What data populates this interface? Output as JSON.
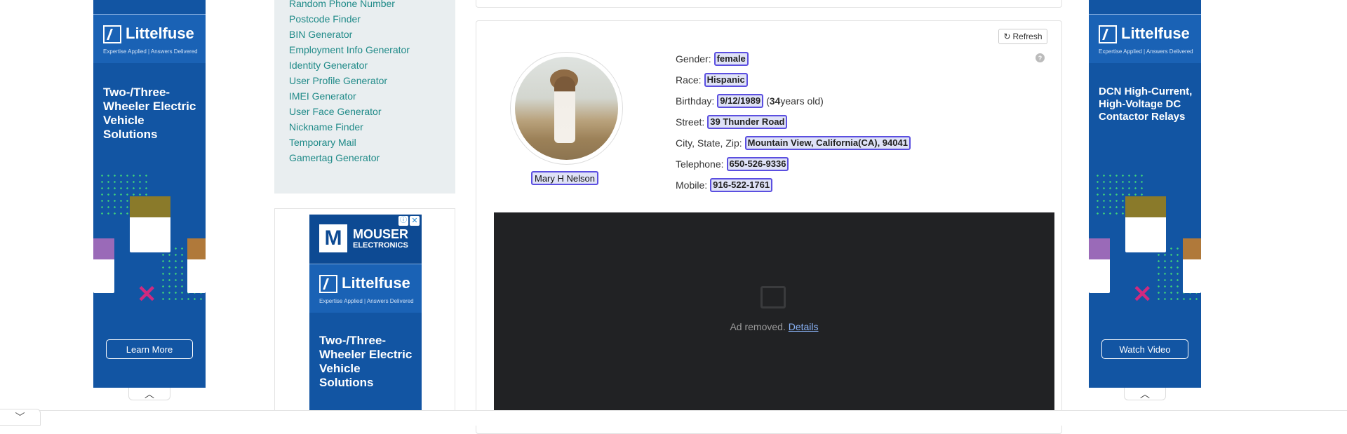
{
  "left_ad": {
    "brand": "Littelfuse",
    "tagline": "Expertise Applied | Answers Delivered",
    "headline": "Two-/Three-Wheeler Electric Vehicle Solutions",
    "cta": "Learn More"
  },
  "right_ad": {
    "brand": "Littelfuse",
    "tagline": "Expertise Applied | Answers Delivered",
    "headline": "DCN High-Current, High-Voltage DC Contactor Relays",
    "cta": "Watch Video"
  },
  "sidebar": {
    "links": [
      "Random Phone Number",
      "Postcode Finder",
      "BIN Generator",
      "Employment Info Generator",
      "Identity Generator",
      "User Profile Generator",
      "IMEI Generator",
      "User Face Generator",
      "Nickname Finder",
      "Temporary Mail",
      "Gamertag Generator"
    ]
  },
  "sidebar_ad": {
    "mouser_line1": "MOUSER",
    "mouser_line2": "ELECTRONICS",
    "brand": "Littelfuse",
    "tagline": "Expertise Applied | Answers Delivered",
    "headline": "Two-/Three-Wheeler Electric Vehicle Solutions"
  },
  "profile": {
    "refresh_label": "Refresh",
    "name": "Mary H Nelson",
    "gender_label": "Gender:",
    "gender": "female",
    "race_label": "Race:",
    "race": "Hispanic",
    "birthday_label": "Birthday:",
    "birthday": "9/12/1989",
    "age_prefix": "(",
    "age": "34",
    "age_suffix": " years old)",
    "street_label": "Street:",
    "street": "39 Thunder Road",
    "city_label": "City, State, Zip:",
    "city": "Mountain View, California(CA), 94041",
    "telephone_label": "Telephone:",
    "telephone": "650-526-9336",
    "mobile_label": "Mobile:",
    "mobile": "916-522-1761"
  },
  "ad_removed": {
    "message": "Ad removed.",
    "details": "Details"
  }
}
